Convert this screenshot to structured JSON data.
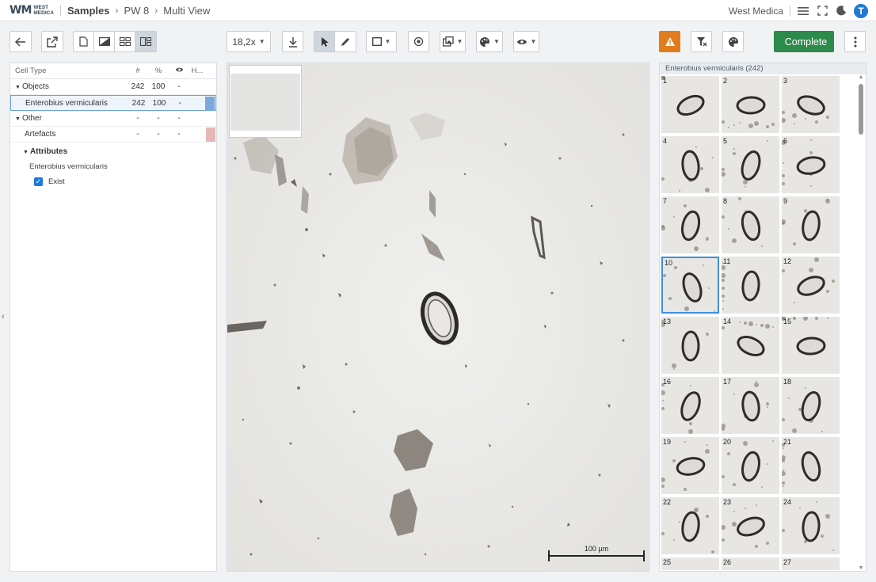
{
  "brand": {
    "logo_mark": "WM",
    "logo_line1": "WEST",
    "logo_line2": "MEDICA"
  },
  "breadcrumb": {
    "root": "Samples",
    "sample": "PW 8",
    "view": "Multi View"
  },
  "header": {
    "org_name": "West Medica",
    "avatar_letter": "T"
  },
  "toolbar": {
    "zoom_value": "18,2x",
    "complete_label": "Complete"
  },
  "left_panel": {
    "columns": {
      "name": "Cell Type",
      "count": "#",
      "percent": "%",
      "hidden": "H..."
    },
    "rows": [
      {
        "label": "Objects",
        "count": "242",
        "percent": "100",
        "eye": "-",
        "color": ""
      },
      {
        "label": "Enterobius vermicularis",
        "count": "242",
        "percent": "100",
        "eye": "-",
        "color": "#7aa7dc"
      },
      {
        "label": "Other",
        "count": "-",
        "percent": "-",
        "eye": "-",
        "color": ""
      },
      {
        "label": "Artefacts",
        "count": "-",
        "percent": "-",
        "eye": "-",
        "color": "#e8b7b7"
      }
    ],
    "attributes_title": "Attributes",
    "attribute_object": "Enterobius vermicularis",
    "attribute_checkbox": {
      "label": "Exist",
      "checked": true
    }
  },
  "viewer": {
    "scale_label": "100 µm"
  },
  "right_panel": {
    "title": "Enterobius vermicularis (242)",
    "thumbnails": [
      "1",
      "2",
      "3",
      "4",
      "5",
      "6",
      "7",
      "8",
      "9",
      "10",
      "11",
      "12",
      "13",
      "14",
      "15",
      "16",
      "17",
      "18",
      "19",
      "20",
      "21",
      "22",
      "23",
      "24",
      "25",
      "26",
      "27"
    ],
    "selected": "10"
  }
}
